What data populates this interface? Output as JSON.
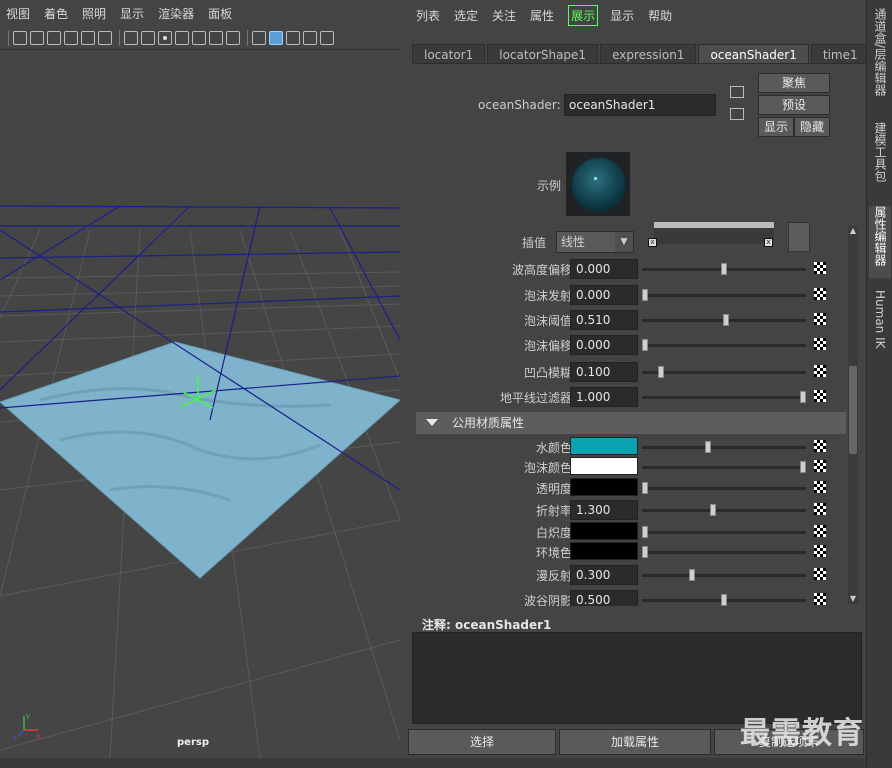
{
  "viewport": {
    "menu": [
      "视图",
      "着色",
      "照明",
      "显示",
      "渲染器",
      "面板"
    ],
    "camera_label": "persp",
    "axis_labels": {
      "y": "y",
      "x": "x",
      "z": "z"
    }
  },
  "attribute_editor": {
    "menu": [
      "列表",
      "选定",
      "关注",
      "属性",
      "展示",
      "显示",
      "帮助"
    ],
    "highlighted_menu": "展示",
    "tabs": [
      "locator1",
      "locatorShape1",
      "expression1",
      "oceanShader1",
      "time1"
    ],
    "active_tab": "oceanShader1",
    "node_label": "oceanShader:",
    "node_value": "oceanShader1",
    "buttons": {
      "focus": "聚焦",
      "presets": "预设",
      "show": "显示",
      "hide": "隐藏"
    },
    "sample_label": "示例",
    "interpolation": {
      "label": "插值",
      "value": "线性"
    },
    "attrs": [
      {
        "label": "波高度偏移",
        "value": "0.000",
        "slider": 0.5
      },
      {
        "label": "泡沫发射",
        "value": "0.000",
        "slider": 0.0
      },
      {
        "label": "泡沫阈值",
        "value": "0.510",
        "slider": 0.51
      },
      {
        "label": "泡沫偏移",
        "value": "0.000",
        "slider": 0.0
      },
      {
        "label": "凹凸模糊",
        "value": "0.100",
        "slider": 0.1
      },
      {
        "label": "地平线过滤器",
        "value": "1.000",
        "slider": 1.0
      }
    ],
    "section_title": "公用材质属性",
    "common_attrs": [
      {
        "label": "水颜色",
        "value": "",
        "color": "#0aa2b0",
        "slider": 0.4
      },
      {
        "label": "泡沫颜色",
        "value": "",
        "color": "#ffffff",
        "slider": 1.0
      },
      {
        "label": "透明度",
        "value": "",
        "color": "#000000",
        "slider": 0.0
      },
      {
        "label": "折射率",
        "value": "1.300",
        "slider": 0.43
      },
      {
        "label": "白炽度",
        "value": "",
        "color": "#000000",
        "slider": 0.0
      },
      {
        "label": "环境色",
        "value": "",
        "color": "#000000",
        "slider": 0.0
      },
      {
        "label": "漫反射",
        "value": "0.300",
        "slider": 0.3
      },
      {
        "label": "波谷阴影",
        "value": "0.500",
        "slider": 0.5
      }
    ],
    "notes_label": "注释:  oceanShader1",
    "bottom_buttons": [
      "选择",
      "加载属性",
      "复制选项卡"
    ]
  },
  "side_tabs": [
    "通道盒/层编辑器",
    "建模工具包",
    "属性编辑器",
    "Human IK"
  ],
  "active_side_tab": "属性编辑器",
  "watermark": "最需教育",
  "colors": {
    "accent_green": "#59ff59",
    "water_color": "#0aa2b0",
    "ocean_plane": "#7fb3cc"
  }
}
